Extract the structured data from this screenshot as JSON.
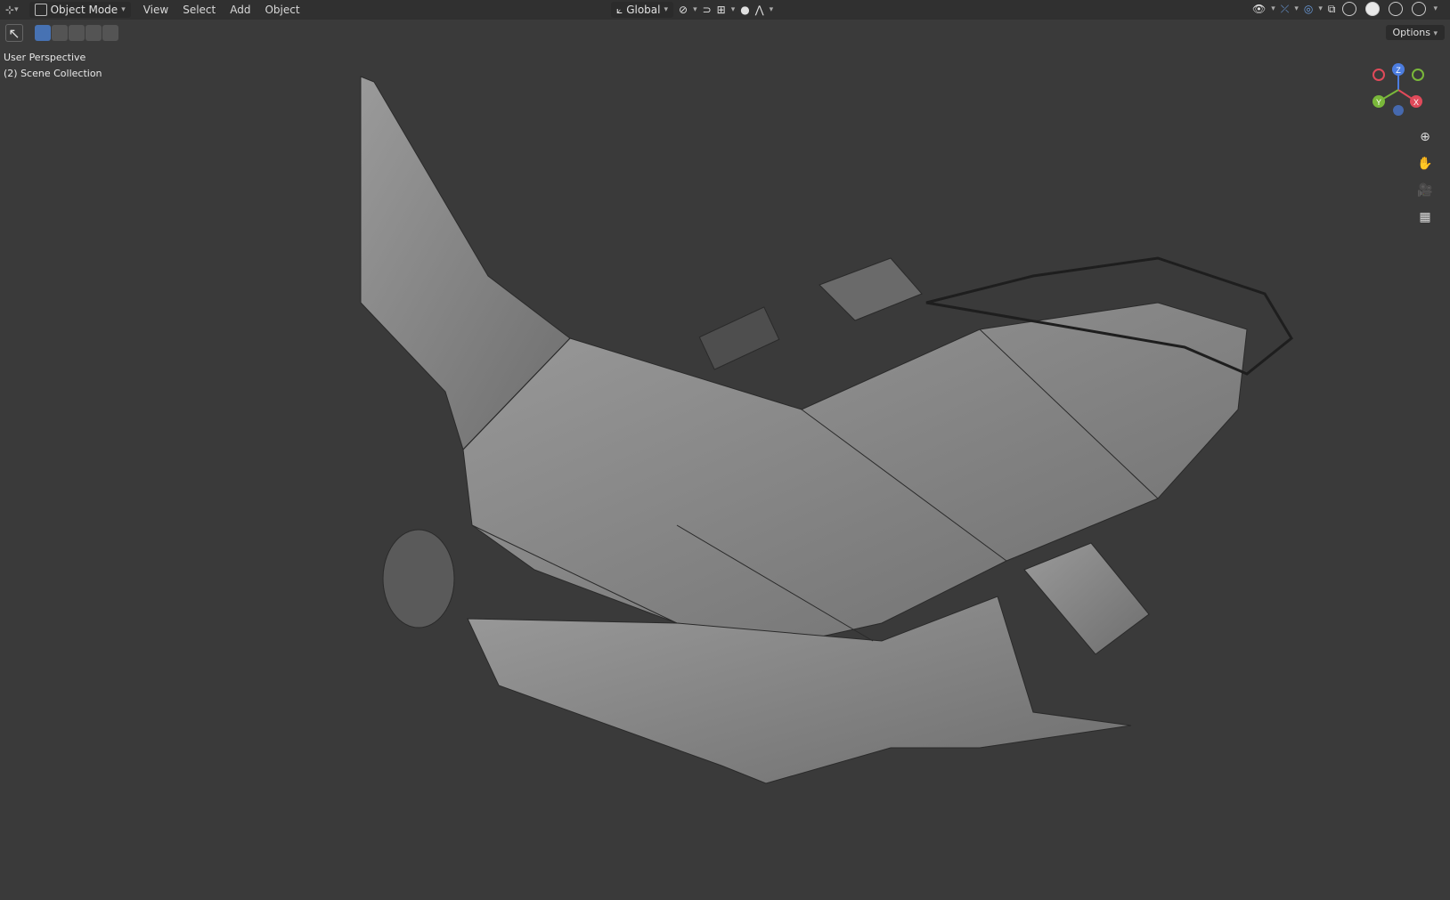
{
  "header": {
    "mode_label": "Object Mode",
    "menus": [
      "View",
      "Select",
      "Add",
      "Object"
    ],
    "orientation_label": "Global",
    "options_label": "Options"
  },
  "viewport": {
    "view_name": "User Perspective",
    "collection_name": "(2) Scene Collection"
  },
  "gizmo": {
    "axes": [
      {
        "label": "Z",
        "color": "#4c7de0"
      },
      {
        "label": "X",
        "color": "#e04a5a"
      },
      {
        "label": "Y",
        "color": "#7ab83a"
      }
    ]
  },
  "nav_icons": [
    "zoom-icon",
    "pan-hand-icon",
    "camera-icon",
    "grid-icon"
  ],
  "colors": {
    "background": "#3a3a3a",
    "accent": "#4772b3",
    "mesh": "#8a8a8a"
  }
}
